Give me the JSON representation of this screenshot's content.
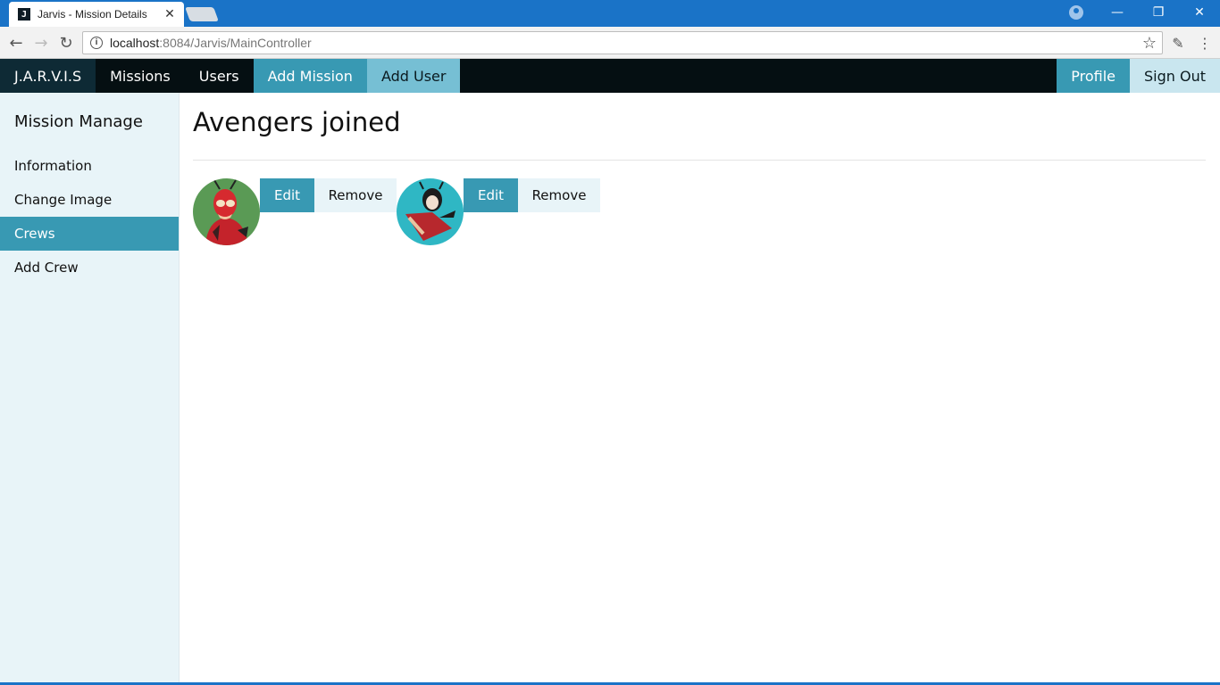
{
  "browser": {
    "tab_title": "Jarvis - Mission Details",
    "tab_favicon": "J",
    "url_host": "localhost",
    "url_path": ":8084/Jarvis/MainController",
    "icons": {
      "account": "account-icon",
      "minimize": "minimize-icon",
      "restore": "restore-icon",
      "close": "close-icon",
      "back": "back-arrow-icon",
      "forward": "forward-arrow-icon",
      "reload": "reload-icon",
      "info": "info-icon",
      "bookmark": "star-icon",
      "eyedropper": "eyedropper-icon",
      "menu": "kebab-menu-icon"
    }
  },
  "navbar": {
    "brand": "J.A.R.V.I.S",
    "items": [
      "Missions",
      "Users",
      "Add Mission",
      "Add User"
    ],
    "profile": "Profile",
    "signout": "Sign Out"
  },
  "sidebar": {
    "heading": "Mission Manage",
    "items": [
      {
        "label": "Information"
      },
      {
        "label": "Change Image"
      },
      {
        "label": "Crews",
        "active": true
      },
      {
        "label": "Add Crew"
      }
    ]
  },
  "main": {
    "title": "Avengers joined",
    "crew": [
      {
        "edit_label": "Edit",
        "remove_label": "Remove",
        "avatar_bg": "#5a9a55"
      },
      {
        "edit_label": "Edit",
        "remove_label": "Remove",
        "avatar_bg": "#2fb7c4"
      }
    ]
  },
  "colors": {
    "navbar_bg": "#050f12",
    "accent": "#3899b3",
    "accent_light": "#76bfd4",
    "sidebar_bg": "#e8f4f8",
    "chrome_blue": "#1a73c7"
  }
}
